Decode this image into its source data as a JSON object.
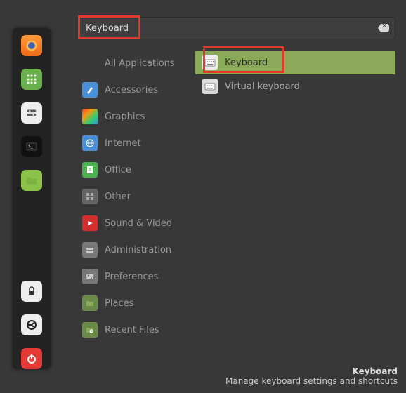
{
  "search": {
    "value": "Keyboard"
  },
  "categories": {
    "all": "All Applications",
    "accessories": "Accessories",
    "graphics": "Graphics",
    "internet": "Internet",
    "office": "Office",
    "other": "Other",
    "sound": "Sound & Video",
    "admin": "Administration",
    "prefs": "Preferences",
    "places": "Places",
    "recent": "Recent Files"
  },
  "results": {
    "keyboard": "Keyboard",
    "virtual": "Virtual keyboard"
  },
  "footer": {
    "title": "Keyboard",
    "desc": "Manage keyboard settings and shortcuts"
  }
}
